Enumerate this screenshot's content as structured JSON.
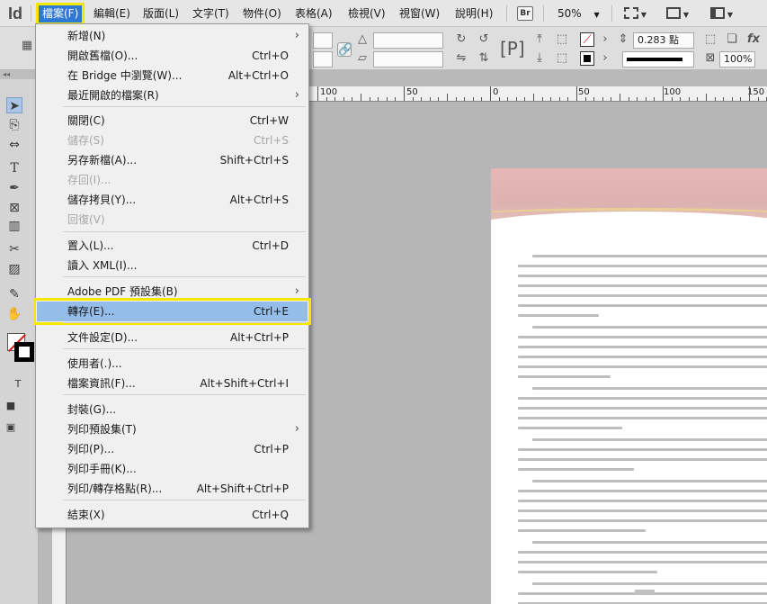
{
  "menubar": {
    "app_logo": "Id",
    "items": [
      {
        "label": "檔案(F)",
        "active": true
      },
      {
        "label": "編輯(E)"
      },
      {
        "label": "版面(L)"
      },
      {
        "label": "文字(T)"
      },
      {
        "label": "物件(O)"
      },
      {
        "label": "表格(A)"
      },
      {
        "label": "檢視(V)"
      },
      {
        "label": "視窗(W)"
      },
      {
        "label": "說明(H)"
      }
    ],
    "bridge_badge": "Br",
    "zoom": "50%",
    "zoom_caret": "▼"
  },
  "control_panel": {
    "stroke_weight": "0.283 點",
    "percent": "100%"
  },
  "rulers": {
    "top_labels": [
      "100",
      "50",
      "0",
      "50",
      "100",
      "150"
    ]
  },
  "file_menu": {
    "items": [
      {
        "label": "新增(N)",
        "submenu": true
      },
      {
        "label": "開啟舊檔(O)...",
        "shortcut": "Ctrl+O"
      },
      {
        "label": "在 Bridge 中瀏覽(W)...",
        "shortcut": "Alt+Ctrl+O"
      },
      {
        "label": "最近開啟的檔案(R)",
        "submenu": true
      },
      {
        "label": "關閉(C)",
        "shortcut": "Ctrl+W"
      },
      {
        "label": "儲存(S)",
        "shortcut": "Ctrl+S",
        "disabled": true
      },
      {
        "label": "另存新檔(A)...",
        "shortcut": "Shift+Ctrl+S"
      },
      {
        "label": "存回(I)...",
        "disabled": true
      },
      {
        "label": "儲存拷貝(Y)...",
        "shortcut": "Alt+Ctrl+S"
      },
      {
        "label": "回復(V)",
        "disabled": true
      },
      {
        "label": "置入(L)...",
        "shortcut": "Ctrl+D"
      },
      {
        "label": "讀入 XML(I)..."
      },
      {
        "label": "Adobe PDF 預設集(B)",
        "submenu": true
      },
      {
        "label": "轉存(E)...",
        "shortcut": "Ctrl+E",
        "highlighted": true
      },
      {
        "label": "文件設定(D)...",
        "shortcut": "Alt+Ctrl+P"
      },
      {
        "label": "使用者(.)..."
      },
      {
        "label": "檔案資訊(F)...",
        "shortcut": "Alt+Shift+Ctrl+I"
      },
      {
        "label": "封裝(G)..."
      },
      {
        "label": "列印預設集(T)",
        "submenu": true
      },
      {
        "label": "列印(P)...",
        "shortcut": "Ctrl+P"
      },
      {
        "label": "列印手冊(K)..."
      },
      {
        "label": "列印/轉存格點(R)...",
        "shortcut": "Alt+Shift+Ctrl+P"
      },
      {
        "label": "結束(X)",
        "shortcut": "Ctrl+Q"
      }
    ],
    "submenu_arrow": "›"
  },
  "toolbar": {
    "collapse": "◂◂"
  }
}
